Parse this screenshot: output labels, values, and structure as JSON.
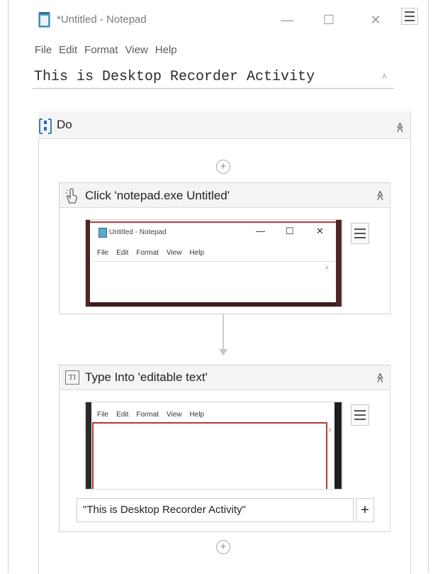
{
  "notepad": {
    "title": "*Untitled - Notepad",
    "menu": [
      "File",
      "Edit",
      "Format",
      "View",
      "Help"
    ],
    "text": "This is Desktop Recorder Activity",
    "window_buttons": {
      "minimize": "—",
      "maximize": "☐",
      "close": "✕"
    }
  },
  "sequence": {
    "label": "Do",
    "collapse_glyph": "≪",
    "add_glyph": "+"
  },
  "click_activity": {
    "title": "Click 'notepad.exe Untitled'",
    "screenshot": {
      "window_title": "Untitled - Notepad",
      "menu": [
        "File",
        "Edit",
        "Format",
        "View",
        "Help"
      ],
      "buttons": {
        "minimize": "—",
        "maximize": "☐",
        "close": "✕"
      }
    }
  },
  "type_activity": {
    "title": "Type Into 'editable text'",
    "screenshot": {
      "menu": [
        "File",
        "Edit",
        "Format",
        "View",
        "Help"
      ]
    },
    "input_value": "\"This is Desktop Recorder Activity\"",
    "plus_label": "+"
  },
  "colors": {
    "highlight_red": "#b73a3a",
    "dark_edge": "#4c2626",
    "header_gray": "#f4f4f4"
  }
}
